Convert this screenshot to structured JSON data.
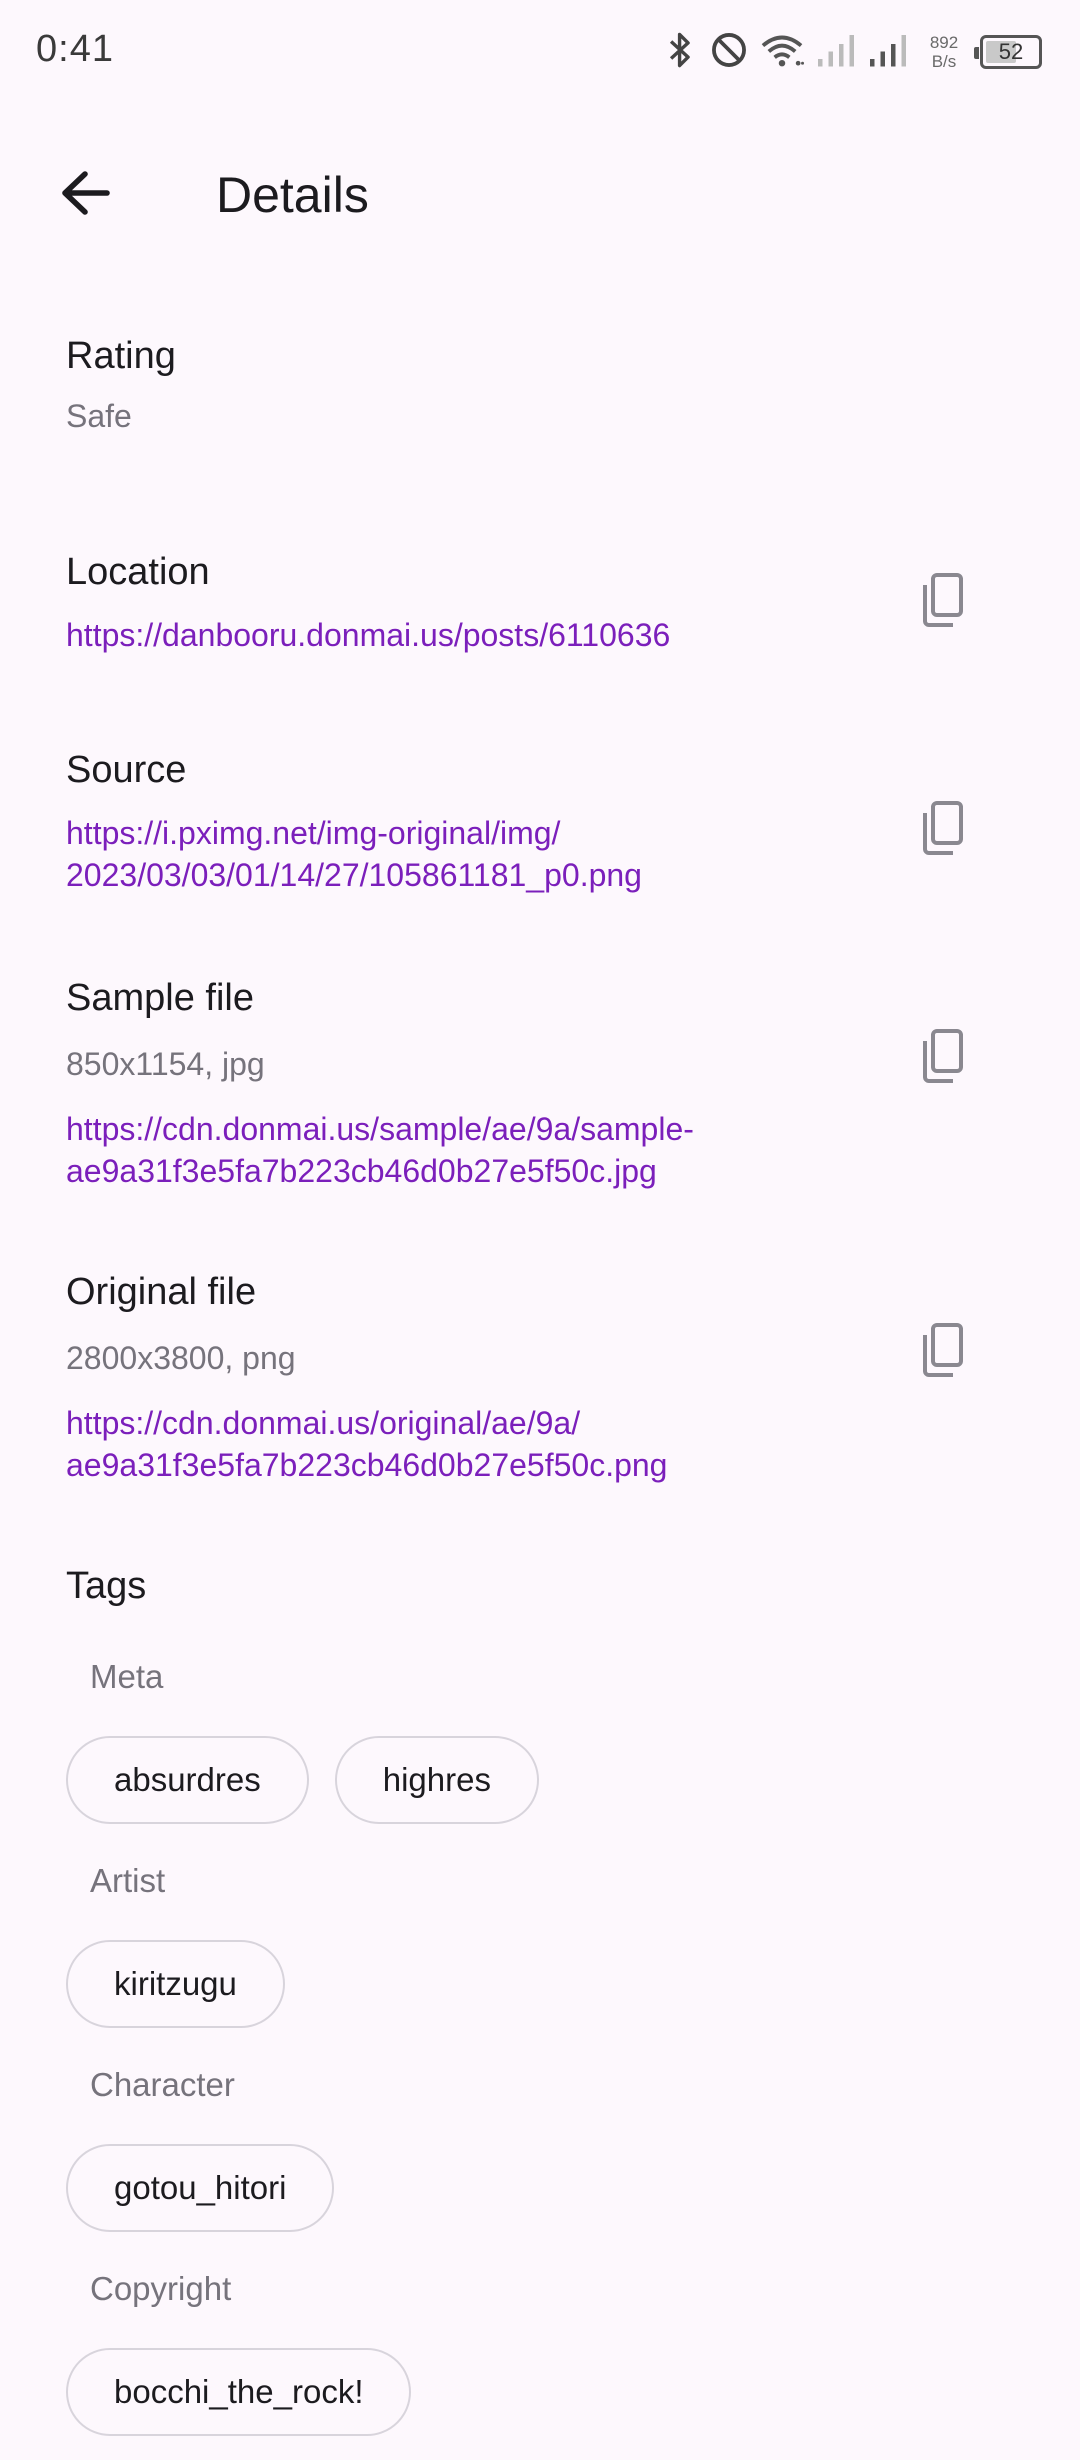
{
  "status": {
    "time": "0:41",
    "net_speed_value": "892",
    "net_speed_unit": "B/s",
    "battery": "52"
  },
  "header": {
    "title": "Details"
  },
  "rating": {
    "title": "Rating",
    "value": "Safe"
  },
  "location": {
    "title": "Location",
    "url": "https://danbooru.donmai.us/posts/6110636"
  },
  "source": {
    "title": "Source",
    "url_line1": "https://i.pximg.net/img-original/img/",
    "url_line2": "2023/03/03/01/14/27/105861181_p0.png"
  },
  "sample_file": {
    "title": "Sample file",
    "info": "850x1154, jpg",
    "url_line1": "https://cdn.donmai.us/sample/ae/9a/sample-",
    "url_line2": "ae9a31f3e5fa7b223cb46d0b27e5f50c.jpg"
  },
  "original_file": {
    "title": "Original file",
    "info": "2800x3800, png",
    "url_line1": "https://cdn.donmai.us/original/ae/9a/",
    "url_line2": "ae9a31f3e5fa7b223cb46d0b27e5f50c.png"
  },
  "tags": {
    "title": "Tags",
    "groups": [
      {
        "label": "Meta",
        "tags": [
          "absurdres",
          "highres"
        ]
      },
      {
        "label": "Artist",
        "tags": [
          "kiritzugu"
        ]
      },
      {
        "label": "Character",
        "tags": [
          "gotou_hitori"
        ]
      },
      {
        "label": "Copyright",
        "tags": [
          "bocchi_the_rock!"
        ]
      }
    ]
  },
  "colors": {
    "link": "#7b1fbb",
    "background": "#fdf8fd",
    "secondary_text": "#76737c"
  },
  "icons": {
    "back": "arrow-left-icon",
    "copy": "copy-icon",
    "bluetooth": "bluetooth-icon",
    "dnd": "do-not-disturb-icon",
    "wifi": "wifi-icon",
    "signal": "cell-signal-icon"
  }
}
